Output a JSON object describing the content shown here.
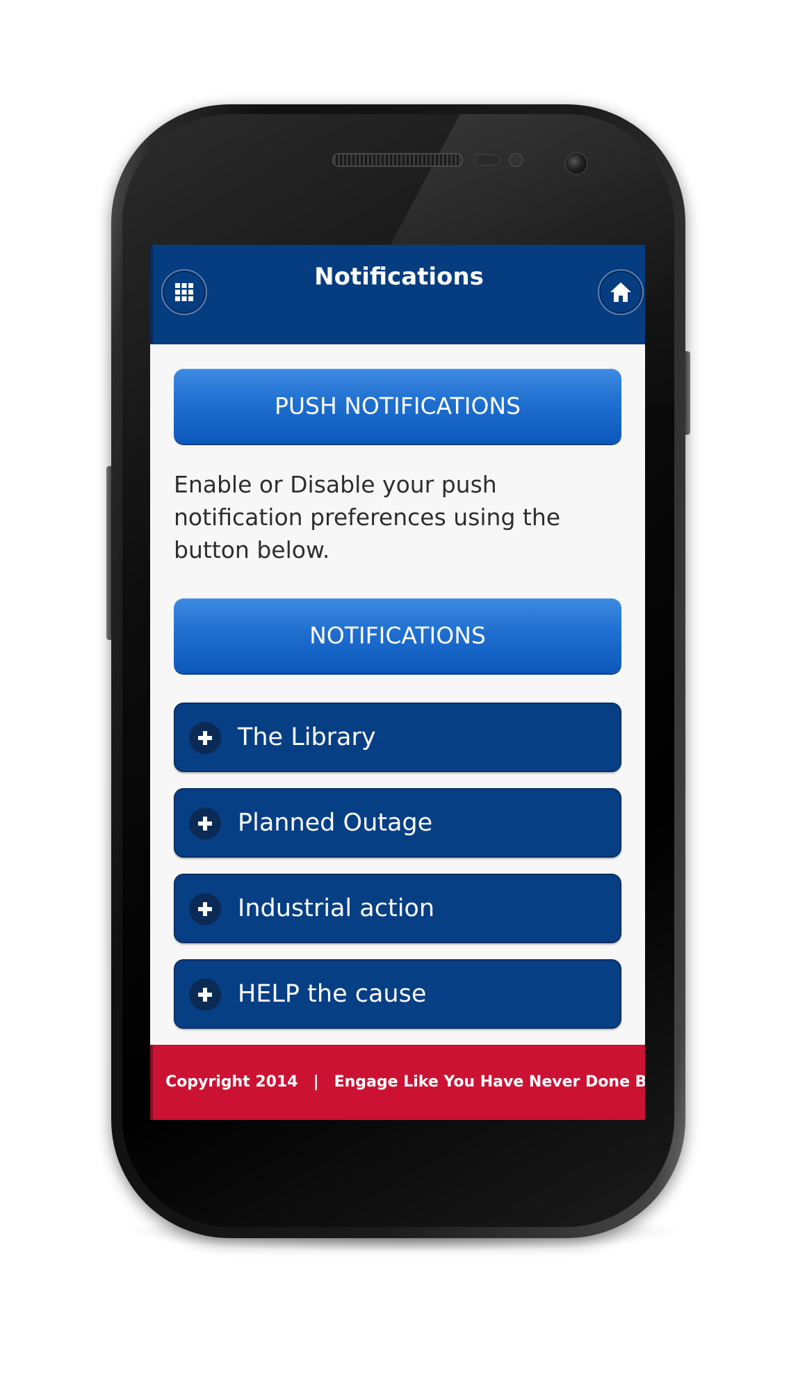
{
  "header": {
    "title": "Notifications",
    "menu_icon": "grid-icon",
    "home_icon": "home-icon"
  },
  "main": {
    "push_section_label": "PUSH NOTIFICATIONS",
    "description": "Enable or Disable your push notification preferences using the button below.",
    "notifications_button_label": "NOTIFICATIONS",
    "topics": [
      {
        "label": "The Library",
        "icon": "plus-icon"
      },
      {
        "label": "Planned Outage",
        "icon": "plus-icon"
      },
      {
        "label": "Industrial action",
        "icon": "plus-icon"
      },
      {
        "label": "HELP the cause",
        "icon": "plus-icon"
      }
    ]
  },
  "footer": {
    "copyright": "Copyright 2014",
    "separator": "|",
    "tagline": "Engage Like You Have Never Done Before"
  },
  "colors": {
    "header_bg": "#063c80",
    "button_blue": "#1f6fd0",
    "topic_bg": "#073f85",
    "footer_bg": "#cc1233",
    "screen_bg": "#f7f7f7"
  }
}
